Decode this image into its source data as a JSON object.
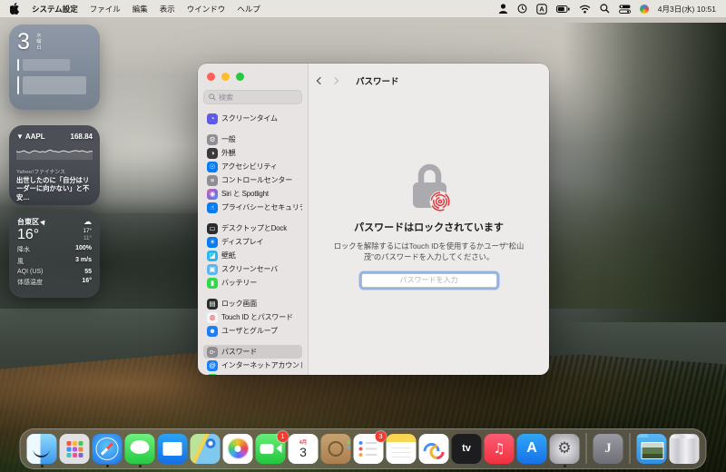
{
  "menu_bar": {
    "items": [
      "システム設定",
      "ファイル",
      "編集",
      "表示",
      "ウインドウ",
      "ヘルプ"
    ],
    "status_icons": [
      "user-switching-icon",
      "clock-icon",
      "input-source-icon",
      "battery-icon",
      "wifi-icon",
      "spotlight-search-icon",
      "control-center-icon",
      "multicolor-orb-icon"
    ],
    "input_source_label": "A",
    "datetime": "4月3日(水) 10:51"
  },
  "widgets": {
    "calendar": {
      "day": "3",
      "weekday": "水曜日"
    },
    "stock": {
      "direction": "▼",
      "symbol": "AAPL",
      "price": "168.84",
      "source": "Yahoo!ファイナンス",
      "headline": "出世したのに「自分はリーダーに向かない」と不安…",
      "sparkline": [
        9,
        8,
        9,
        10,
        8,
        7,
        9,
        10,
        9,
        8,
        9,
        8,
        10,
        11,
        9,
        9,
        8,
        9,
        10,
        9,
        8,
        9,
        10,
        10,
        9,
        10,
        9,
        8,
        9,
        9
      ]
    },
    "weather": {
      "location": "台東区",
      "temp": "16°",
      "high": "17°",
      "low": "11°",
      "rows": [
        {
          "label": "降水",
          "value": "100%"
        },
        {
          "label": "風",
          "value": "3 m/s"
        },
        {
          "label": "AQI (US)",
          "value": "55"
        },
        {
          "label": "体感温度",
          "value": "16°"
        }
      ]
    }
  },
  "window": {
    "sidebar": {
      "search_placeholder": "検索",
      "groups": [
        [
          {
            "label": "スクリーンタイム",
            "icon": "screen-time-icon",
            "color": "#5e5ce6",
            "glyph": "◔"
          }
        ],
        [
          {
            "label": "一般",
            "icon": "general-icon",
            "color": "#8e8e93",
            "glyph": "⚙"
          },
          {
            "label": "外観",
            "icon": "appearance-icon",
            "color": "#3a3a3c",
            "glyph": "◑"
          },
          {
            "label": "アクセシビリティ",
            "icon": "accessibility-icon",
            "color": "#0a7cf2",
            "glyph": "☉"
          },
          {
            "label": "コントロールセンター",
            "icon": "control-center-icon",
            "color": "#8e8e93",
            "glyph": "≡"
          },
          {
            "label": "Siri と Spotlight",
            "icon": "siri-icon",
            "color": "siri",
            "glyph": "◉"
          },
          {
            "label": "プライバシーとセキュリティ",
            "icon": "privacy-security-icon",
            "color": "#0a7cf2",
            "glyph": "☝"
          }
        ],
        [
          {
            "label": "デスクトップとDock",
            "icon": "desktop-dock-icon",
            "color": "#2c2c2e",
            "glyph": "▭"
          },
          {
            "label": "ディスプレイ",
            "icon": "displays-icon",
            "color": "#0a7cf2",
            "glyph": "☀"
          },
          {
            "label": "壁紙",
            "icon": "wallpaper-icon",
            "color": "#2fb5e8",
            "glyph": "◪"
          },
          {
            "label": "スクリーンセーバ",
            "icon": "screensaver-icon",
            "color": "#59b8f2",
            "glyph": "▣"
          },
          {
            "label": "バッテリー",
            "icon": "battery-icon",
            "color": "#32d74b",
            "glyph": "▮"
          }
        ],
        [
          {
            "label": "ロック画面",
            "icon": "lock-screen-icon",
            "color": "#2c2c2e",
            "glyph": "▤"
          },
          {
            "label": "Touch ID とパスワード",
            "icon": "touch-id-icon",
            "color": "#f5f5fa",
            "glyph": "◍",
            "glyph_color": "#e0383e"
          },
          {
            "label": "ユーザとグループ",
            "icon": "users-groups-icon",
            "color": "#1e7ef7",
            "glyph": "☻"
          }
        ],
        [
          {
            "label": "パスワード",
            "icon": "passwords-icon",
            "color": "#8e8e93",
            "glyph": "o-",
            "selected": true
          },
          {
            "label": "インターネットアカウント",
            "icon": "internet-accounts-icon",
            "color": "#1e7ef7",
            "glyph": "@"
          },
          {
            "label": "",
            "icon": "game-center-icon",
            "color": "#41d45a",
            "glyph": "",
            "partial": true
          }
        ]
      ]
    },
    "header": {
      "title": "パスワード"
    },
    "content": {
      "lock_title": "パスワードはロックされています",
      "lock_description": "ロックを解除するにはTouch IDを使用するかユーザ“松山茂”のパスワードを入力してください。",
      "password_placeholder": "パスワードを入力"
    }
  },
  "dock": {
    "items": [
      {
        "name": "finder",
        "dot": true
      },
      {
        "name": "launchpad"
      },
      {
        "name": "safari",
        "dot": true
      },
      {
        "name": "messages",
        "dot": true
      },
      {
        "name": "mail"
      },
      {
        "name": "maps"
      },
      {
        "name": "photos"
      },
      {
        "name": "facetime",
        "badge": "1"
      },
      {
        "name": "calendar",
        "cal_top": "4月",
        "cal_day": "3"
      },
      {
        "name": "contacts"
      },
      {
        "name": "reminders",
        "badge": "3"
      },
      {
        "name": "notes"
      },
      {
        "name": "freeform"
      },
      {
        "name": "appletv",
        "label": "tv"
      },
      {
        "name": "music"
      },
      {
        "name": "appstore"
      },
      {
        "name": "settings",
        "dot": true
      },
      {
        "separator": true
      },
      {
        "name": "jfolder",
        "letter": "J"
      },
      {
        "separator": true
      },
      {
        "name": "downloads-folder"
      },
      {
        "name": "trash"
      }
    ]
  }
}
